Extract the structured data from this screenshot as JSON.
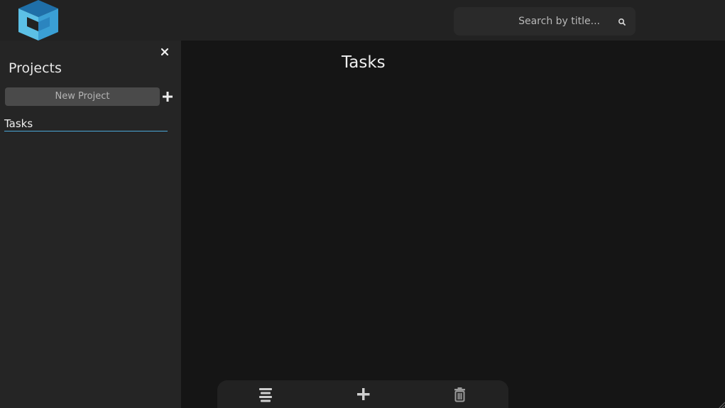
{
  "header": {
    "logo_icon": "cube-logo",
    "search": {
      "placeholder": "Search by title...",
      "value": "",
      "icon": "search-icon"
    }
  },
  "sidebar": {
    "title": "Projects",
    "close_icon": "close-icon",
    "new_project_label": "New Project",
    "add_icon": "plus-icon",
    "projects": [
      {
        "label": "Tasks",
        "selected": true
      }
    ]
  },
  "main": {
    "title": "Tasks"
  },
  "toolbar": {
    "buttons": [
      {
        "name": "menu",
        "icon": "menu-lines-icon"
      },
      {
        "name": "add",
        "icon": "plus-icon"
      },
      {
        "name": "delete",
        "icon": "trash-icon"
      }
    ]
  },
  "colors": {
    "accent": "#4aa7d8",
    "topbar": "#222222",
    "sidebar": "#252525",
    "main": "#151515",
    "logo_dark": "#1f6fa8",
    "logo_light": "#5cc0e6"
  }
}
